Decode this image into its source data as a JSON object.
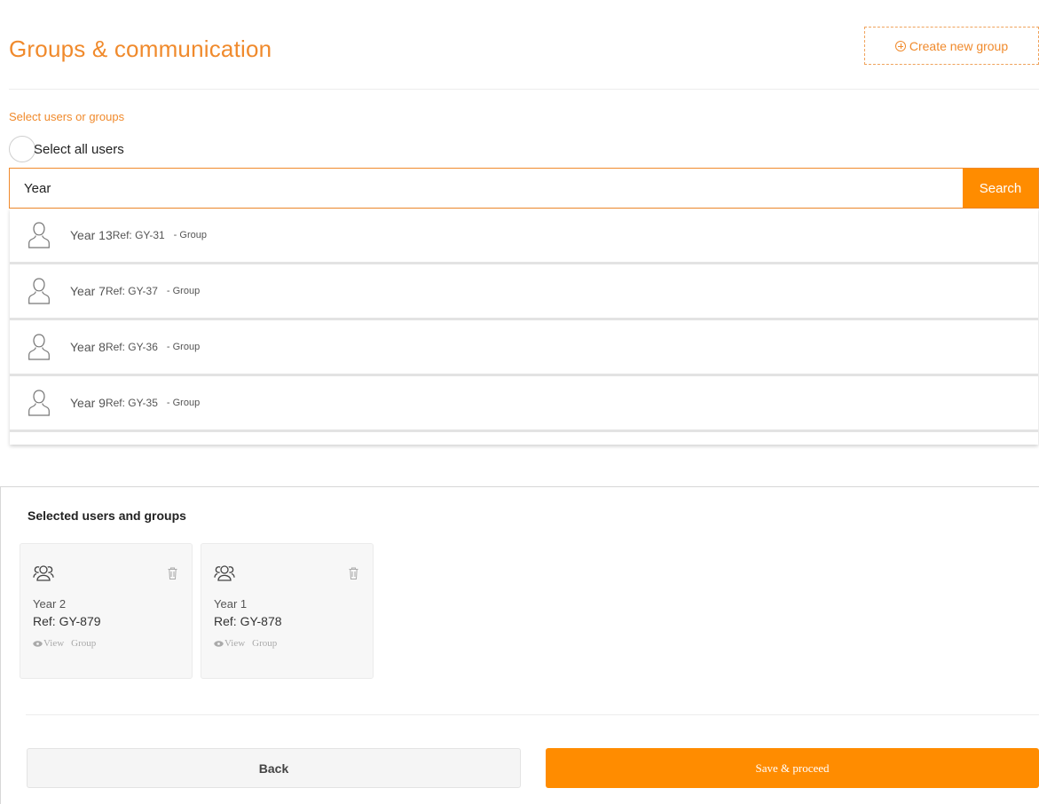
{
  "header": {
    "title": "Groups & communication",
    "create_button_label": "Create new group",
    "create_button_icon": "plus-circle-icon"
  },
  "selection": {
    "label": "Select users or groups",
    "select_all_label": "Select all users",
    "select_all_checked": false
  },
  "search": {
    "value": "Year",
    "button_label": "Search"
  },
  "results": [
    {
      "name": "Year 13",
      "ref": "Ref: GY-31",
      "type": "- Group",
      "icon": "user-icon"
    },
    {
      "name": "Year 7",
      "ref": "Ref: GY-37",
      "type": "- Group",
      "icon": "user-icon"
    },
    {
      "name": "Year 8",
      "ref": "Ref: GY-36",
      "type": "- Group",
      "icon": "user-icon"
    },
    {
      "name": "Year 9",
      "ref": "Ref: GY-35",
      "type": "- Group",
      "icon": "user-icon"
    }
  ],
  "selected": {
    "title": "Selected users and groups",
    "items": [
      {
        "name": "Year 2",
        "ref": "Ref: GY-879",
        "view_label": "View",
        "type": "Group",
        "icon": "group-icon"
      },
      {
        "name": "Year 1",
        "ref": "Ref: GY-878",
        "view_label": "View",
        "type": "Group",
        "icon": "group-icon"
      }
    ]
  },
  "actions": {
    "back_label": "Back",
    "save_label": "Save & proceed"
  },
  "colors": {
    "accent": "#ff8c00",
    "accent_text": "#f08a2c"
  }
}
